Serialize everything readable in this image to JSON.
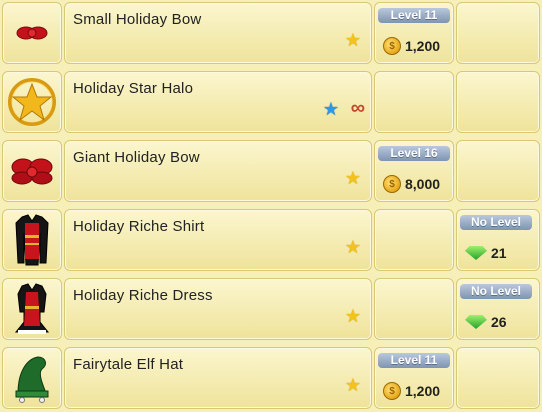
{
  "items": [
    {
      "name": "Small Holiday Bow",
      "icon": "small-bow-icon",
      "favorite": "gold-star-icon",
      "level_label": "Level 11",
      "currency": "gold",
      "price": "1,200"
    },
    {
      "name": "Holiday Star Halo",
      "icon": "star-halo-icon",
      "favorite": "blue-star-icon",
      "duration_icon": "infinity-icon",
      "level_label": "",
      "currency": "",
      "price": ""
    },
    {
      "name": "Giant Holiday Bow",
      "icon": "giant-bow-icon",
      "favorite": "gold-star-icon",
      "level_label": "Level 16",
      "currency": "gold",
      "price": "8,000"
    },
    {
      "name": "Holiday Riche Shirt",
      "icon": "shirt-icon",
      "favorite": "gold-star-icon",
      "level_label": "No Level",
      "currency": "gems",
      "price": "21"
    },
    {
      "name": "Holiday Riche Dress",
      "icon": "dress-icon",
      "favorite": "gold-star-icon",
      "level_label": "No Level",
      "currency": "gems",
      "price": "26"
    },
    {
      "name": "Fairytale Elf Hat",
      "icon": "elf-hat-icon",
      "favorite": "gold-star-icon",
      "level_label": "Level 11",
      "currency": "gold",
      "price": "1,200"
    }
  ],
  "symbols": {
    "star": "★",
    "infinity": "∞",
    "coin": "$"
  },
  "colors": {
    "background": "#f7efb8",
    "gold_star": "#f4c21f",
    "blue_star": "#2a9ae8",
    "level_pill": "#8fa2bd",
    "gem": "#24a32a"
  }
}
